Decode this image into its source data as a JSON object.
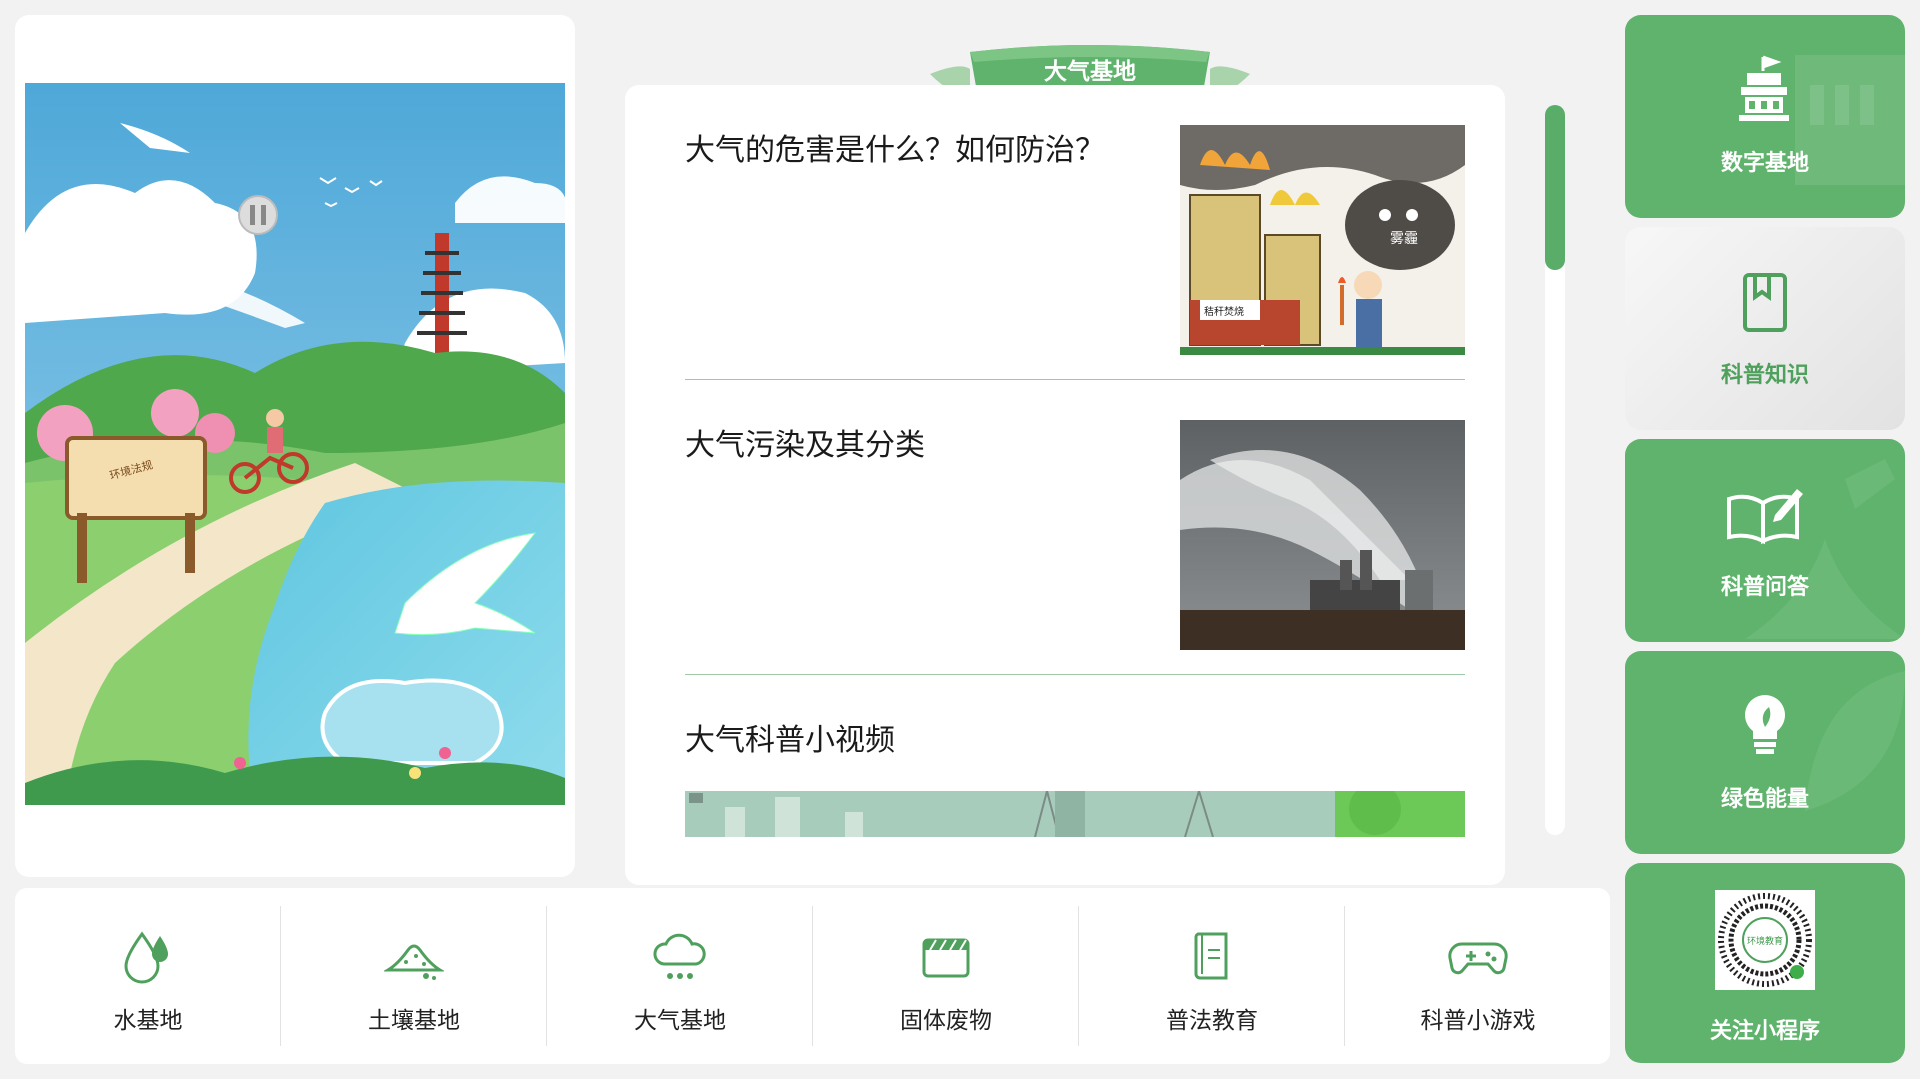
{
  "header": {
    "title": "大气基地"
  },
  "articles": [
    {
      "title": "大气的危害是什么？如何防治？"
    },
    {
      "title": "大气污染及其分类"
    },
    {
      "title": "大气科普小视频"
    }
  ],
  "illustration": {
    "sign_text": "环境法规"
  },
  "sidebar": {
    "items": [
      {
        "label": "数字基地",
        "icon": "government-building-icon",
        "active": false
      },
      {
        "label": "科普知识",
        "icon": "bookmark-book-icon",
        "active": true
      },
      {
        "label": "科普问答",
        "icon": "open-book-pen-icon",
        "active": false
      },
      {
        "label": "绿色能量",
        "icon": "lightbulb-leaf-icon",
        "active": false
      }
    ],
    "qr": {
      "label": "关注小程序",
      "qr_text": "环境教育"
    }
  },
  "bottom_nav": [
    {
      "label": "水基地",
      "icon": "water-drop-icon"
    },
    {
      "label": "土壤基地",
      "icon": "soil-mound-icon"
    },
    {
      "label": "大气基地",
      "icon": "cloud-icon"
    },
    {
      "label": "固体废物",
      "icon": "clapperboard-icon"
    },
    {
      "label": "普法教育",
      "icon": "law-book-icon"
    },
    {
      "label": "科普小游戏",
      "icon": "gamepad-icon"
    }
  ],
  "thumb_labels": {
    "cloud_label": "雾霾",
    "sign_label": "秸秆焚烧"
  },
  "colors": {
    "primary": "#5fb36c",
    "accent_dark": "#3f9a4d",
    "divider": "#9ec8a6"
  }
}
